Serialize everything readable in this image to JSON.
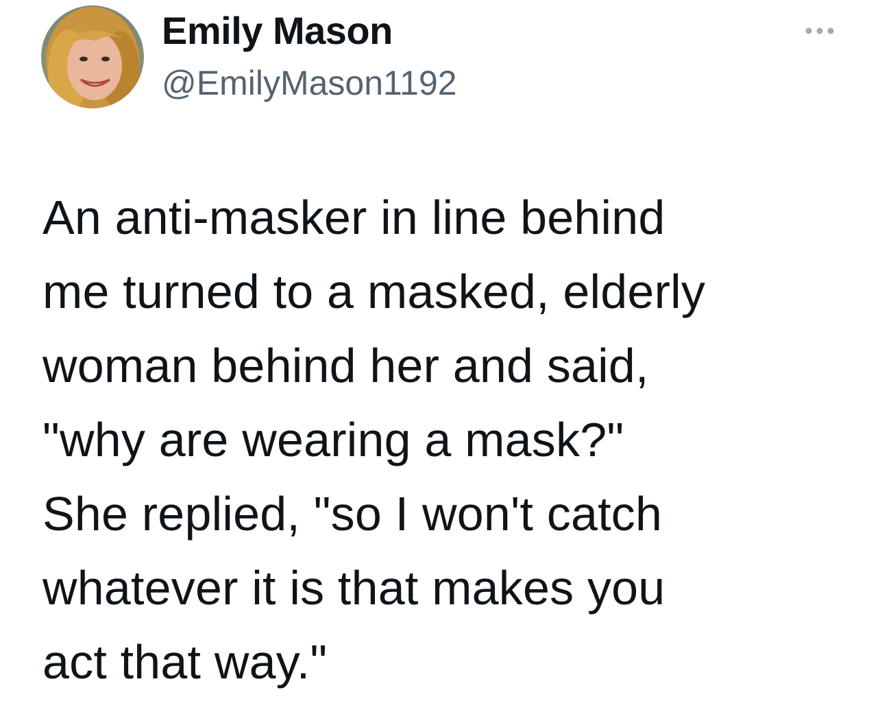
{
  "tweet": {
    "author": {
      "display_name": "Emily Mason",
      "handle": "@EmilyMason1192",
      "avatar_icon": "profile-photo"
    },
    "more_icon": "more-horizontal-icon",
    "text_lines": [
      "An anti-masker in line behind",
      "me turned to a masked, elderly",
      "woman behind her and said,",
      "\"why are wearing a mask?\"",
      "She replied, \"so I won't catch",
      "whatever it is that makes you",
      "act that way.\""
    ]
  },
  "colors": {
    "text": "#0f1419",
    "secondary": "#536471",
    "background": "#ffffff"
  }
}
